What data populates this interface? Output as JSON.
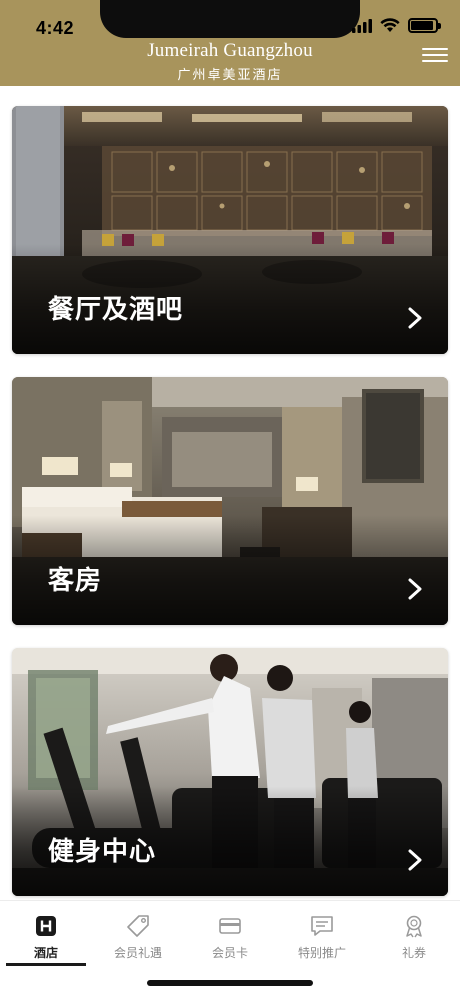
{
  "status_bar": {
    "time": "4:42"
  },
  "header": {
    "brand_en": "Jumeirah Guangzhou",
    "brand_cn": "广州卓美亚酒店",
    "menu_icon": "hamburger-menu-icon"
  },
  "cards": [
    {
      "label": "餐厅及酒吧",
      "image": "restaurant-lounge-photo"
    },
    {
      "label": "客房",
      "image": "guest-room-photo"
    },
    {
      "label": "健身中心",
      "image": "fitness-center-photo"
    }
  ],
  "tabbar": {
    "active_index": 0,
    "items": [
      {
        "label": "酒店",
        "icon": "hotel-h-icon"
      },
      {
        "label": "会员礼遇",
        "icon": "tag-icon"
      },
      {
        "label": "会员卡",
        "icon": "card-icon"
      },
      {
        "label": "特别推广",
        "icon": "message-icon"
      },
      {
        "label": "礼券",
        "icon": "award-ribbon-icon"
      }
    ]
  },
  "colors": {
    "brand_gold": "#a8945c",
    "tab_inactive": "#8a8a8a",
    "tab_active": "#222222"
  }
}
